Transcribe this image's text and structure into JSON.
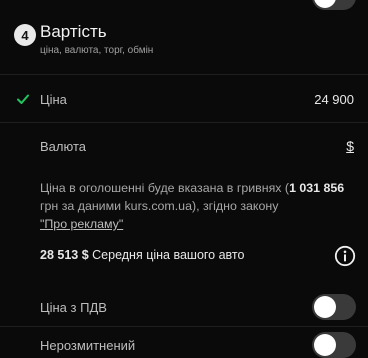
{
  "section": {
    "step_number": "4",
    "title": "Вартість",
    "subtitle": "ціна, валюта, торг, обмін"
  },
  "price_row": {
    "check_icon": "check-icon",
    "label": "Ціна",
    "value": "24 900",
    "accent_color": "#22c55e"
  },
  "currency_row": {
    "label": "Валюта",
    "value": "$"
  },
  "notice": {
    "text_before": "Ціна в оголошенні буде вказана в гривнях (",
    "amount": "1 031 856",
    "text_after": "грн за даними kurs.com.ua), згідно закону",
    "law_link": "\"Про рекламу\""
  },
  "average": {
    "amount": "28 513 $",
    "label": "Середня ціна вашого авто",
    "info_icon": "info-icon"
  },
  "options": [
    {
      "label": "Ціна з ПДВ",
      "enabled": false
    },
    {
      "label": "Нерозмитнений",
      "enabled": false
    }
  ]
}
